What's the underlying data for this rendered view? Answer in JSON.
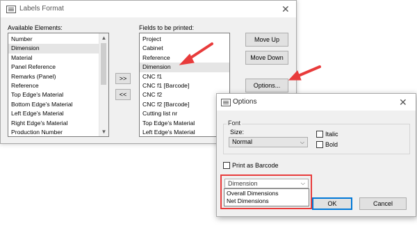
{
  "labels_format": {
    "title": "Labels Format",
    "available_label": "Available Elements:",
    "fields_label": "Fields to be printed:",
    "available_items": [
      "Number",
      "Dimension",
      "Material",
      "Panel Reference",
      "Remarks (Panel)",
      "Reference",
      "Top Edge's Material",
      "Bottom Edge's Material",
      "Left Edge's Material",
      "Right Edge's Material",
      "Production Number"
    ],
    "available_selected": "Dimension",
    "fields_items": [
      "Project",
      "Cabinet",
      "Reference",
      "Dimension",
      "CNC f1",
      "CNC f1 [Barcode]",
      "CNC f2",
      "CNC f2 [Barcode]",
      "Cutting list nr",
      "Top Edge's Material",
      "Left Edge's Material"
    ],
    "fields_selected": "Dimension",
    "add_button": ">>",
    "remove_button": "<<",
    "move_up": "Move Up",
    "move_down": "Move Down",
    "options": "Options..."
  },
  "options_dialog": {
    "title": "Options",
    "font_group": "Font",
    "size_label": "Size:",
    "size_value": "Normal",
    "italic": "Italic",
    "bold": "Bold",
    "italic_checked": false,
    "bold_checked": false,
    "print_barcode": "Print as Barcode",
    "print_barcode_checked": false,
    "dimension_select": "Dimension",
    "dimension_options": [
      "Overall Dimensions",
      "Net Dimensions"
    ],
    "ok": "OK",
    "cancel": "Cancel"
  },
  "colors": {
    "annotation_red": "#e83b3b",
    "selection_bg": "#e5e5e5",
    "focus_blue": "#0078d7"
  }
}
